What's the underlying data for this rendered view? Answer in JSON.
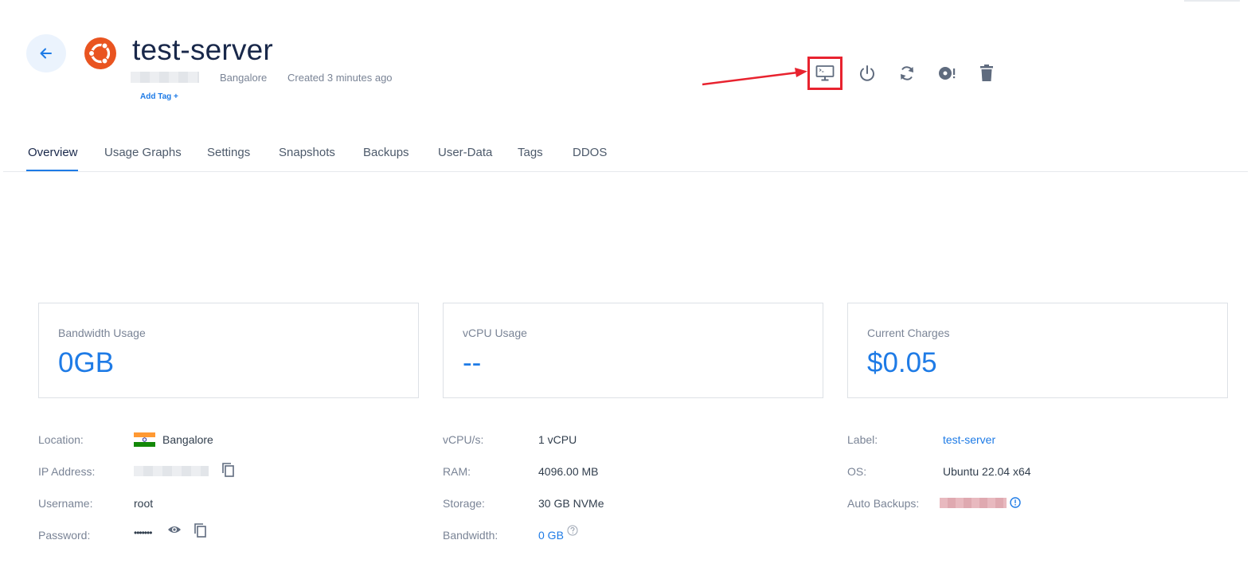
{
  "header": {
    "title": "test-server",
    "location": "Bangalore",
    "created": "Created 3 minutes ago",
    "add_tag": "Add Tag +"
  },
  "actions": [
    {
      "name": "console",
      "icon": "monitor-console-icon",
      "highlighted": true
    },
    {
      "name": "power",
      "icon": "power-icon"
    },
    {
      "name": "restart",
      "icon": "restart-icon"
    },
    {
      "name": "reinstall",
      "icon": "disc-alert-icon"
    },
    {
      "name": "destroy",
      "icon": "trash-icon"
    }
  ],
  "tabs": [
    "Overview",
    "Usage Graphs",
    "Settings",
    "Snapshots",
    "Backups",
    "User-Data",
    "Tags",
    "DDOS"
  ],
  "active_tab": "Overview",
  "cards": [
    {
      "label": "Bandwidth Usage",
      "value": "0GB"
    },
    {
      "label": "vCPU Usage",
      "value": "--"
    },
    {
      "label": "Current Charges",
      "value": "$0.05"
    }
  ],
  "details": {
    "left": {
      "location_label": "Location:",
      "location_value": "Bangalore",
      "ip_label": "IP Address:",
      "username_label": "Username:",
      "username_value": "root",
      "password_label": "Password:",
      "password_value": "•••••••"
    },
    "middle": {
      "vcpu_label": "vCPU/s:",
      "vcpu_value": "1 vCPU",
      "ram_label": "RAM:",
      "ram_value": "4096.00 MB",
      "storage_label": "Storage:",
      "storage_value": "30 GB NVMe",
      "bandwidth_label": "Bandwidth:",
      "bandwidth_value": "0 GB"
    },
    "right": {
      "label_label": "Label:",
      "label_value": "test-server",
      "os_label": "OS:",
      "os_value": "Ubuntu 22.04 x64",
      "backups_label": "Auto Backups:"
    }
  },
  "colors": {
    "accent": "#1e7be6",
    "highlight": "#e8232f",
    "ubuntu": "#e95420"
  }
}
